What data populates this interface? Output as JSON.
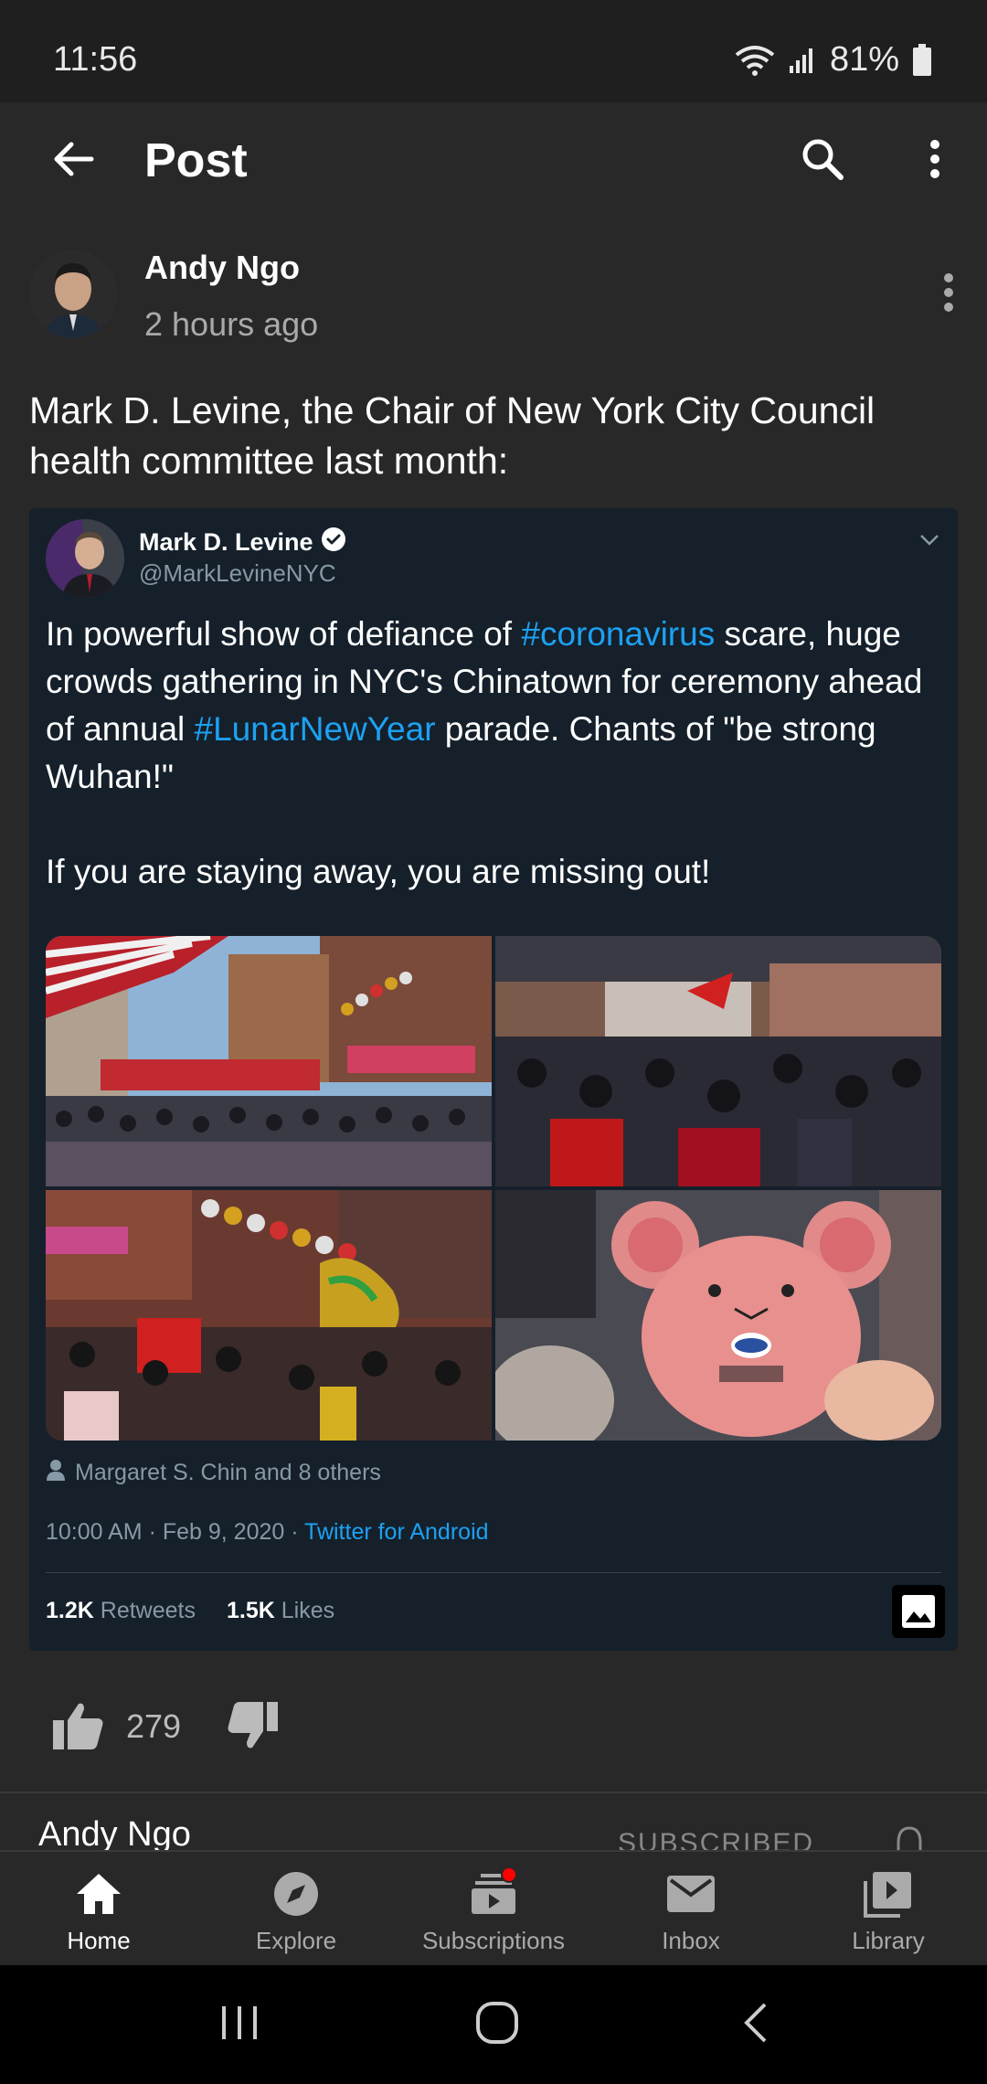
{
  "status": {
    "time": "11:56",
    "battery": "81%"
  },
  "header": {
    "title": "Post",
    "back_icon": "arrow-left-icon",
    "search_icon": "search-icon",
    "more_icon": "more-vert-icon"
  },
  "post": {
    "author": "Andy Ngo",
    "time": "2 hours ago",
    "text": "Mark D. Levine, the Chair of New York City Council health committee last month:",
    "likes": "279"
  },
  "tweet": {
    "name": "Mark D. Levine",
    "handle": "@MarkLevineNYC",
    "text_1a": "In powerful show of defiance of ",
    "hashtag_1": "#coronavirus",
    "text_1b": " scare, huge crowds gathering in NYC's Chinatown for ceremony ahead of annual ",
    "hashtag_2": "#LunarNewYear",
    "text_1c": " parade. Chants of \"be strong Wuhan!\"",
    "text_2": "If you are staying away, you are missing out!",
    "tagged": "Margaret S. Chin and 8 others",
    "timestamp": "10:00 AM · Feb 9, 2020 · ",
    "source": "Twitter for Android",
    "retweets_count": "1.2K",
    "retweets_label": "Retweets",
    "likes_count": "1.5K",
    "likes_label": "Likes",
    "link_color": "#1da1f2"
  },
  "below": {
    "channel": "Andy Ngo",
    "subscribed": "SUBSCRIBED"
  },
  "nav": {
    "items": [
      {
        "label": "Home",
        "icon": "home-icon"
      },
      {
        "label": "Explore",
        "icon": "compass-icon"
      },
      {
        "label": "Subscriptions",
        "icon": "subscriptions-icon"
      },
      {
        "label": "Inbox",
        "icon": "mail-icon"
      },
      {
        "label": "Library",
        "icon": "library-icon"
      }
    ]
  }
}
